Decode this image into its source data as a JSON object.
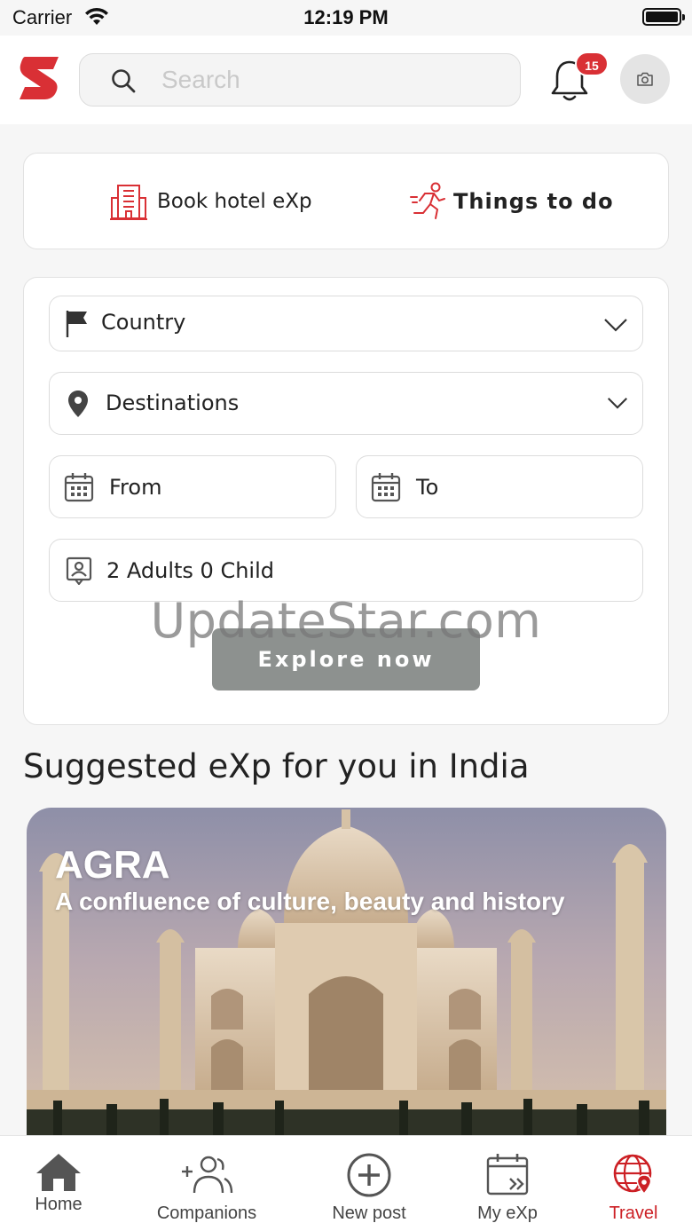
{
  "status_bar": {
    "carrier": "Carrier",
    "time": "12:19 PM"
  },
  "header": {
    "search_placeholder": "Search",
    "notification_count": "15",
    "logo_icon": "brand-s-logo",
    "camera_icon": "camera-icon"
  },
  "mode_toggle": {
    "hotel_label": "Book hotel eXp",
    "things_label": "Things to do"
  },
  "booking_form": {
    "country_label": "Country",
    "destinations_label": "Destinations",
    "from_label": "From",
    "to_label": "To",
    "guests_label": "2 Adults 0 Child",
    "explore_button": "Explore now"
  },
  "watermark": "UpdateStar.com",
  "suggested": {
    "heading": "Suggested eXp for you in India",
    "card_title": "AGRA",
    "card_subtitle": "A confluence of culture, beauty and history"
  },
  "tabbar": {
    "tabs": [
      {
        "label": "Home",
        "icon": "home-icon"
      },
      {
        "label": "Companions",
        "icon": "companions-icon"
      },
      {
        "label": "New post",
        "icon": "plus-circle-icon"
      },
      {
        "label": "My eXp",
        "icon": "calendar-arrow-icon"
      },
      {
        "label": "Travel",
        "icon": "globe-pin-icon"
      }
    ],
    "active_tab": "Travel"
  },
  "colors": {
    "brand_red": "#d93035",
    "active_tab": "#cc1f24",
    "button_gray": "#8d918f",
    "background": "#f6f6f6"
  }
}
